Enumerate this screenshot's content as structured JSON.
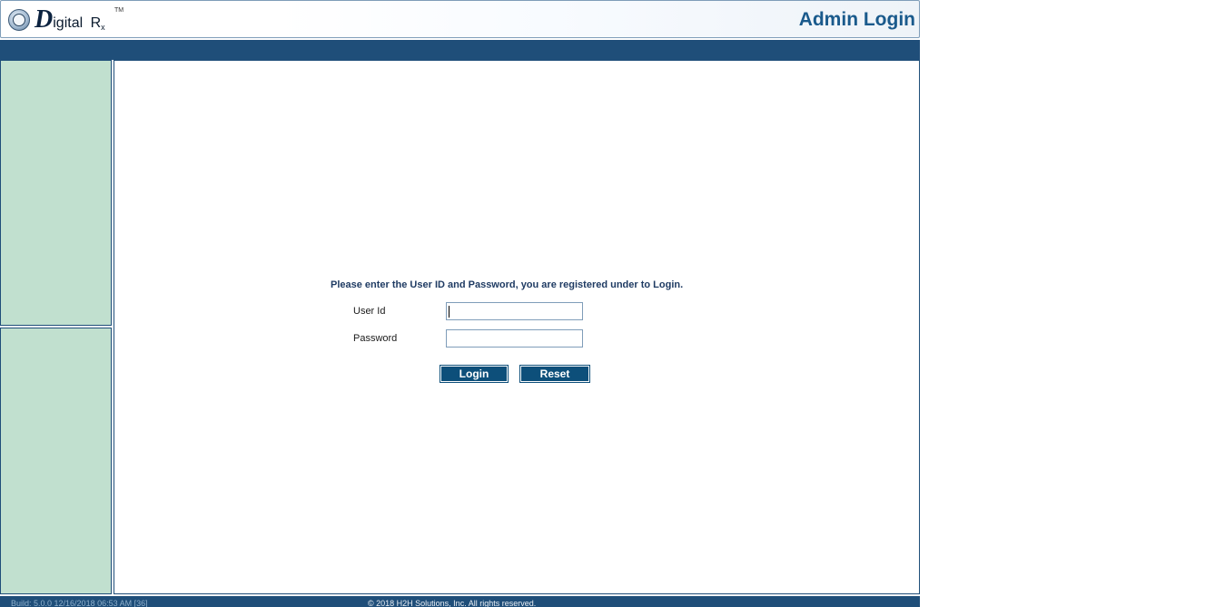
{
  "header": {
    "logo": {
      "brand_initial": "D",
      "brand_rest": "igital",
      "rx_main": "R",
      "rx_sub": "x",
      "trademark": "TM"
    },
    "title": "Admin Login"
  },
  "login": {
    "instruction": "Please enter the User ID and Password, you are registered under to Login.",
    "user_id_label": "User Id",
    "user_id_value": "",
    "password_label": "Password",
    "password_value": "",
    "login_button": "Login",
    "reset_button": "Reset"
  },
  "footer": {
    "build": "Build: 5.0.0 12/16/2018 06:53 AM [36]",
    "copyright": "© 2018 H2H Solutions, Inc. All rights reserved."
  },
  "colors": {
    "nav_bar": "#1f4e79",
    "side_panel": "#c1e0cf",
    "button": "#0d4f7a",
    "title": "#1a5a8c"
  },
  "icons": {
    "logo_seal": "seal-icon"
  }
}
